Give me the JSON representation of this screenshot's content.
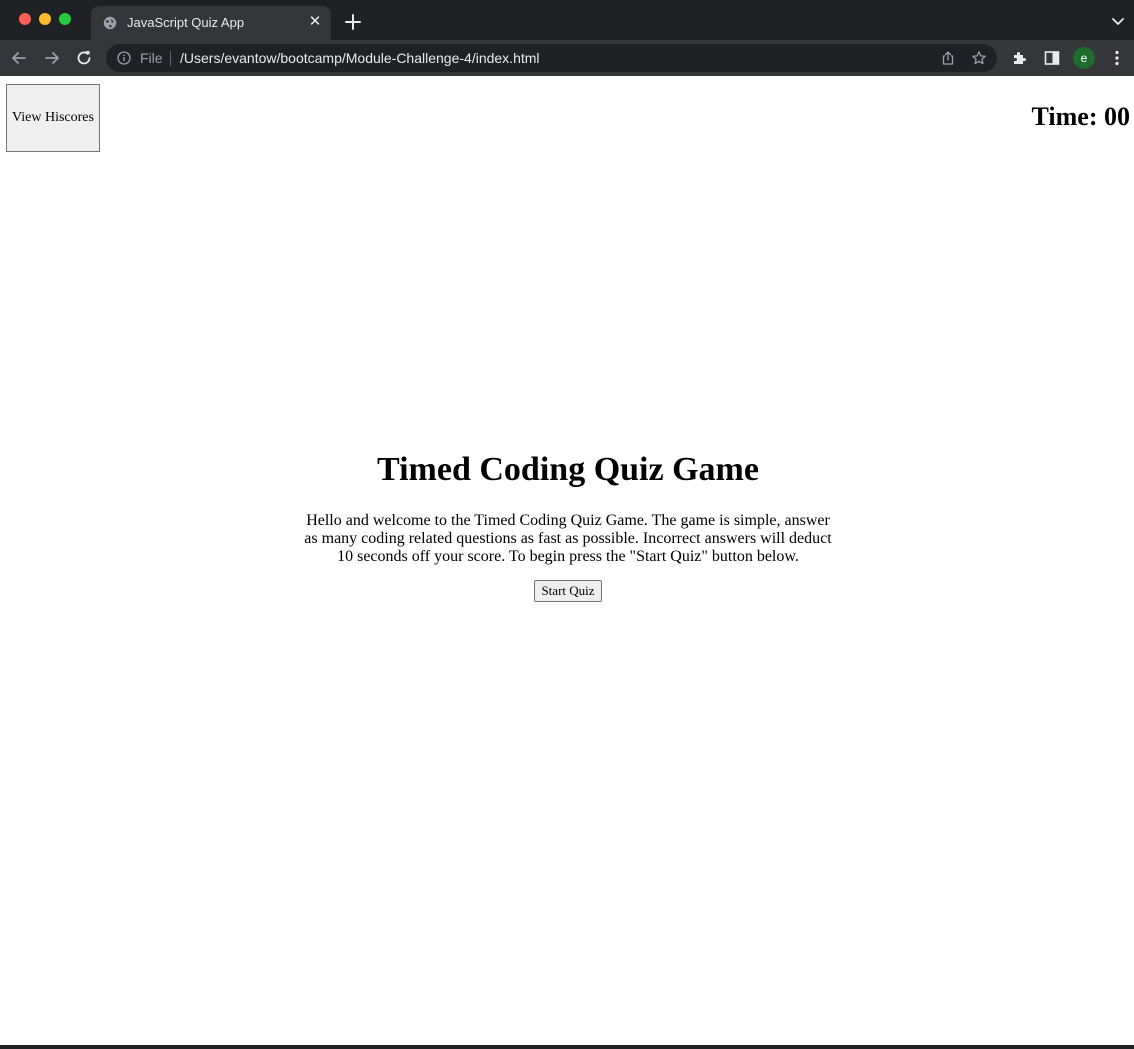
{
  "browser": {
    "tab_title": "JavaScript Quiz App",
    "tab_close": "✕",
    "url_scheme_label": "File",
    "url": "/Users/evantow/bootcamp/Module-Challenge-4/index.html",
    "profile_initial": "e",
    "icons": [
      "globe-icon",
      "close-icon",
      "plus-icon",
      "chevron-down-icon",
      "back-icon",
      "forward-icon",
      "reload-icon",
      "info-icon",
      "share-icon",
      "star-icon",
      "puzzle-icon",
      "side-panel-icon",
      "kebab-menu-icon"
    ]
  },
  "page": {
    "hiscores_label": "View Hiscores",
    "timer_text": "Time: 00",
    "title": "Timed Coding Quiz Game",
    "description": "Hello and welcome to the Timed Coding Quiz Game. The game is simple, answer as many coding related questions as fast as possible. Incorrect answers will deduct 10 seconds off your score. To begin press the \"Start Quiz\" button below.",
    "start_label": "Start Quiz"
  }
}
